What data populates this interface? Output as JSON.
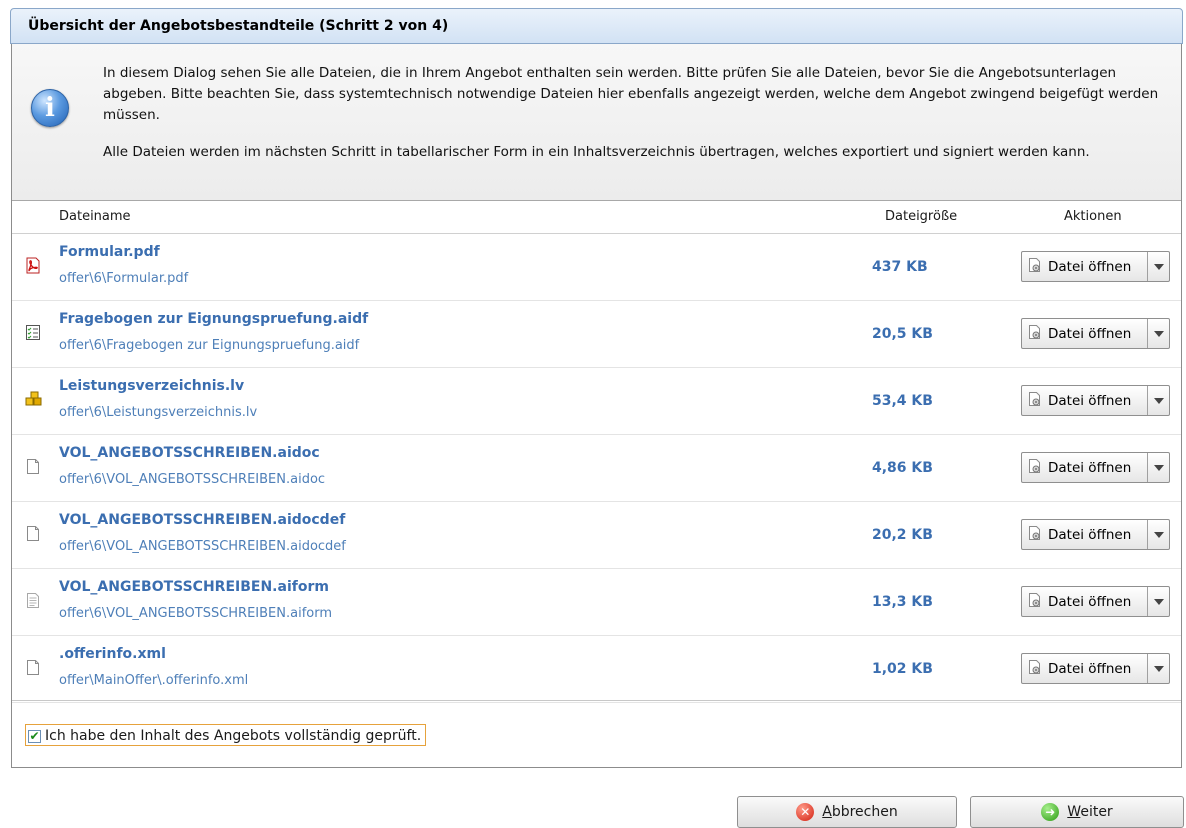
{
  "dialog": {
    "title": "Übersicht der Angebotsbestandteile (Schritt 2 von 4)"
  },
  "info": {
    "paragraph1": "In diesem Dialog sehen Sie alle Dateien, die in Ihrem Angebot enthalten sein werden. Bitte prüfen Sie alle Dateien, bevor Sie die Angebotsunterlagen abgeben. Bitte beachten Sie, dass systemtechnisch notwendige Dateien hier ebenfalls angezeigt werden, welche dem Angebot zwingend beigefügt werden müssen.",
    "paragraph2": "Alle Dateien werden im nächsten Schritt in tabellarischer Form in ein Inhaltsverzeichnis übertragen, welches exportiert und signiert werden kann.",
    "icon": "info-icon"
  },
  "table": {
    "headers": {
      "name": "Dateiname",
      "size": "Dateigröße",
      "actions": "Aktionen"
    },
    "action_label": "Datei öffnen",
    "rows": [
      {
        "name": "Formular.pdf",
        "path": "offer\\6\\Formular.pdf",
        "size": "437 KB",
        "icon": "pdf-icon"
      },
      {
        "name": "Fragebogen zur Eignungspruefung.aidf",
        "path": "offer\\6\\Fragebogen zur Eignungspruefung.aidf",
        "size": "20,5 KB",
        "icon": "checklist-icon"
      },
      {
        "name": "Leistungsverzeichnis.lv",
        "path": "offer\\6\\Leistungsverzeichnis.lv",
        "size": "53,4 KB",
        "icon": "blocks-icon"
      },
      {
        "name": "VOL_ANGEBOTSSCHREIBEN.aidoc",
        "path": "offer\\6\\VOL_ANGEBOTSSCHREIBEN.aidoc",
        "size": "4,86 KB",
        "icon": "blank-file-icon"
      },
      {
        "name": "VOL_ANGEBOTSSCHREIBEN.aidocdef",
        "path": "offer\\6\\VOL_ANGEBOTSSCHREIBEN.aidocdef",
        "size": "20,2 KB",
        "icon": "blank-file-icon"
      },
      {
        "name": "VOL_ANGEBOTSSCHREIBEN.aiform",
        "path": "offer\\6\\VOL_ANGEBOTSSCHREIBEN.aiform",
        "size": "13,3 KB",
        "icon": "text-file-icon"
      },
      {
        "name": ".offerinfo.xml",
        "path": "offer\\MainOffer\\.offerinfo.xml",
        "size": "1,02 KB",
        "icon": "blank-file-icon"
      }
    ]
  },
  "confirm": {
    "label": "Ich habe den Inhalt des Angebots vollständig geprüft.",
    "checked": true
  },
  "buttons": {
    "cancel_label": "Abbrechen",
    "next_label": "Weiter"
  }
}
